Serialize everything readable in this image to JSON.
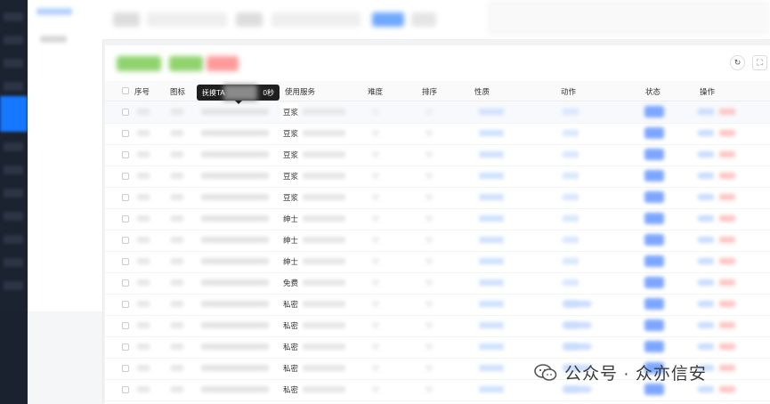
{
  "table": {
    "headers": [
      "序号",
      "图标",
      "使用服务",
      "难度",
      "排序",
      "性质",
      "动作",
      "状态",
      "操作"
    ],
    "rows": [
      {
        "service": "豆浆"
      },
      {
        "service": "豆浆"
      },
      {
        "service": "豆浆"
      },
      {
        "service": "豆浆"
      },
      {
        "service": "豆浆"
      },
      {
        "service": "绅士"
      },
      {
        "service": "绅士"
      },
      {
        "service": "绅士"
      },
      {
        "service": "免费"
      },
      {
        "service": "私密"
      },
      {
        "service": "私密"
      },
      {
        "service": "私密"
      },
      {
        "service": "私密"
      },
      {
        "service": "私密"
      }
    ]
  },
  "tooltip": {
    "prefix": "抚摸TA",
    "suffix": "0秒"
  },
  "toolbar": {
    "refresh_icon": "↻",
    "fullscreen_icon": "⛶"
  },
  "watermark": {
    "text": "公众号 · 众亦信安"
  },
  "colors": {
    "accent": "#1677ff",
    "sidebar_dark": "#1c2330",
    "success": "#52c41a",
    "danger": "#ff4d4f"
  }
}
